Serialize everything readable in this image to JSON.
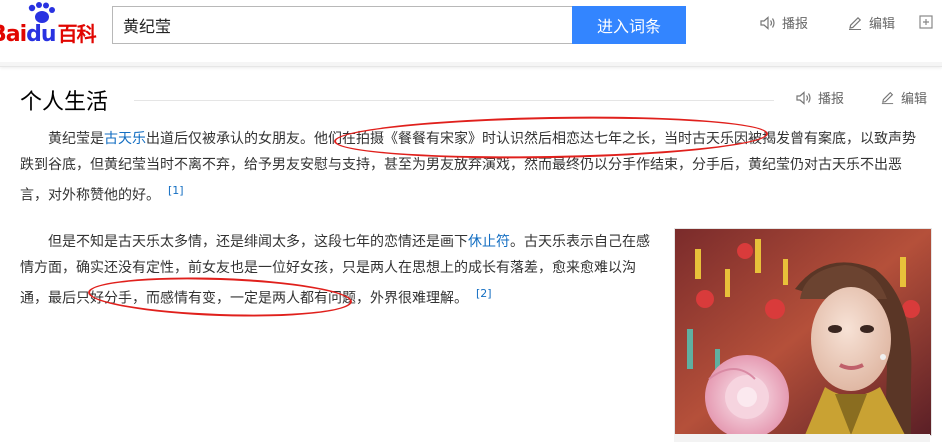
{
  "header": {
    "logo_bai": "Bai",
    "logo_du": "du",
    "logo_baike": "百科",
    "search_value": "黄纪莹",
    "search_button": "进入词条",
    "read_label": "播报",
    "edit_label": "编辑"
  },
  "section": {
    "title": "个人生活",
    "read_label": "播报",
    "edit_label": "编辑"
  },
  "paragraph1": {
    "t1": "黄纪莹是",
    "link1": "古天乐",
    "t2": "出道后仅被承认的女朋友。他们在拍摄《餐餐有宋家》时认识然后相恋达七年之长，当时古天乐因被揭发曾有案底，以致声势跌到谷底，但黄纪莹当时不离不弃，给予男友安慰与支持，甚至为男友放弃演戏，然而最终仍以分手作结束，分手后，黄纪莹仍对古天乐不出恶言，对外称赞他的好。",
    "ref": "[1]"
  },
  "paragraph2": {
    "t1": "但是不知是古天乐太多情，还是绯闻太多，这段七年的恋情还是画下",
    "link1": "休止符",
    "t2": "。古天乐表示自己在感情方面，确实还没有定性，前女友也是一位好女孩，只是两人在思想上的成长有落差，愈来愈难以沟通，最后只好分手，而感情有变，一定是两人都有问题，外界很难理解。",
    "ref": "[2]"
  },
  "colors": {
    "accent": "#3385ff",
    "link": "#136ec2",
    "annotation": "#e0201c"
  }
}
